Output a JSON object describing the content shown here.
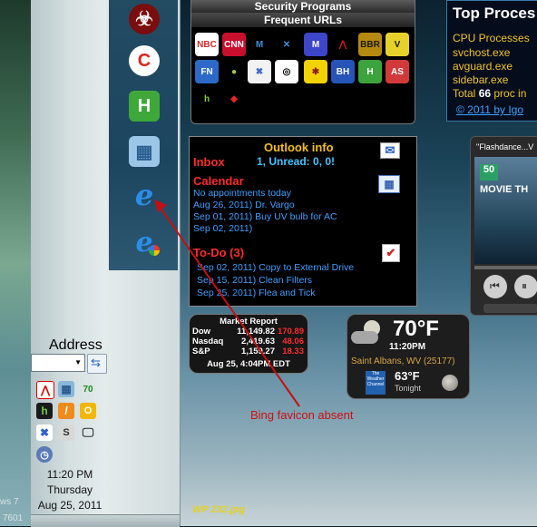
{
  "security_frame": {
    "title": "Security Programs",
    "subtitle": "Frequent URLs",
    "favicons": [
      {
        "name": "nbc-icon",
        "text": "NBC",
        "bg": "#ffffff",
        "fg": "#d02b2b"
      },
      {
        "name": "cnn-icon",
        "text": "CNN",
        "bg": "#c8102e",
        "fg": "#ffffff"
      },
      {
        "name": "malwarebytes-icon",
        "text": "M",
        "bg": "#000000",
        "fg": "#3f8fe0"
      },
      {
        "name": "tools-icon",
        "text": "✕",
        "bg": "#000000",
        "fg": "#3f8fe0"
      },
      {
        "name": "mcafee-icon",
        "text": "M",
        "bg": "#3d45c8",
        "fg": "#ffffff"
      },
      {
        "name": "avira-icon",
        "text": "⋀",
        "bg": "#000000",
        "fg": "#e01d1d"
      },
      {
        "name": "bbr-icon",
        "text": "BBR",
        "bg": "#b68a10",
        "fg": "#1a1a1a"
      },
      {
        "name": "v-icon",
        "text": "V",
        "bg": "#e6d12a",
        "fg": "#1a1a1a"
      },
      {
        "name": "fn-icon",
        "text": "FN",
        "bg": "#2d6ac8",
        "fg": "#ffffff"
      },
      {
        "name": "drop-icon",
        "text": "●",
        "bg": "#000000",
        "fg": "#9ed04a"
      },
      {
        "name": "lock-icon",
        "text": "✖",
        "bg": "#f2f2f2",
        "fg": "#3a6ad0"
      },
      {
        "name": "ring-icon",
        "text": "◎",
        "bg": "#ffffff",
        "fg": "#000000"
      },
      {
        "name": "bug-icon",
        "text": "✱",
        "bg": "#f2d200",
        "fg": "#8a1f1f"
      },
      {
        "name": "bh-icon",
        "text": "BH",
        "bg": "#2654b8",
        "fg": "#ffffff"
      },
      {
        "name": "h-icon",
        "text": "H",
        "bg": "#3da33d",
        "fg": "#ffffff"
      },
      {
        "name": "as-icon",
        "text": "AS",
        "bg": "#d23a3a",
        "fg": "#ffffff"
      },
      {
        "name": "h-green-icon",
        "text": "h",
        "bg": "#000000",
        "fg": "#7ccf3a"
      },
      {
        "name": "red-diamond-icon",
        "text": "◆",
        "bg": "#000000",
        "fg": "#e02626"
      }
    ]
  },
  "top_processes": {
    "title": "Top Proces",
    "items": [
      "CPU Processes",
      "svchost.exe",
      "avguard.exe",
      "sidebar.exe"
    ],
    "total_prefix": "Total ",
    "total_count": "66",
    "total_suffix": " proc in",
    "copyright": "© 2011 by Igo"
  },
  "outlook": {
    "title": "Outlook info",
    "inbox_label": "Inbox",
    "inbox_status": "1, Unread: 0, 0!",
    "calendar_label": "Calendar",
    "calendar_items": [
      "No appointments today",
      "Aug 26, 2011) Dr. Vargo",
      "Sep 01, 2011) Buy UV bulb for AC",
      "Sep 02, 2011)"
    ],
    "todo_label": "To-Do (3)",
    "todo_items": [
      "Sep 02, 2011)  Copy to External Drive",
      "Sep 15, 2011)  Clean Filters",
      "Sep 25, 2011)  Flea and Tick"
    ]
  },
  "market": {
    "title": "Market Report",
    "rows": [
      {
        "name": "Dow",
        "value": "11,149.82",
        "change": "170.89"
      },
      {
        "name": "Nasdaq",
        "value": "2,419.63",
        "change": "48.06"
      },
      {
        "name": "S&P",
        "value": "1,159.27",
        "change": "18.33"
      }
    ],
    "timestamp": "Aug 25, 4:04PM EDT"
  },
  "weather": {
    "temp": "70°F",
    "time": "11:20PM",
    "location": "Saint Albans, WV (25177)",
    "tonight_temp": "63°F",
    "tonight_label": "Tonight",
    "channel_text": "The Weather Channel"
  },
  "player": {
    "title": "\"Flashdance...V",
    "badge": "50",
    "movie_text": "MOVIE TH"
  },
  "sidebar": {
    "address_label": "Address",
    "time": "11:20 PM",
    "day": "Thursday",
    "date": "Aug 25, 2011",
    "build_frag_1": "ws 7",
    "build_frag_2": "7601"
  },
  "annotation": {
    "text": "Bing favicon absent",
    "color": "#cc1010"
  },
  "wallpaper_caption": "WP 232.jpg"
}
